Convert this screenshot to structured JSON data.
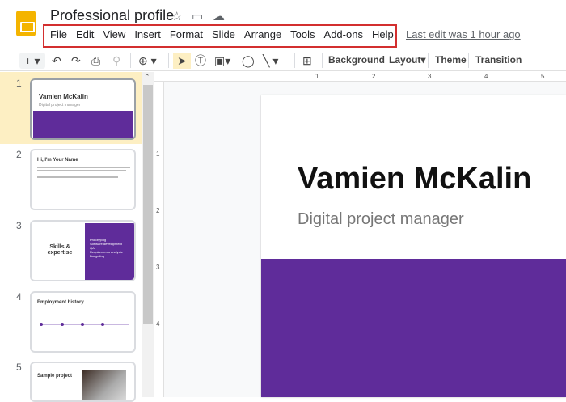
{
  "title": "Professional profile",
  "menu": [
    "File",
    "Edit",
    "View",
    "Insert",
    "Format",
    "Slide",
    "Arrange",
    "Tools",
    "Add-ons",
    "Help"
  ],
  "last_edit": "Last edit was 1 hour ago",
  "toolbar": {
    "background": "Background",
    "layout": "Layout",
    "theme": "Theme",
    "transition": "Transition"
  },
  "ruler": [
    "1",
    "2",
    "3",
    "4",
    "5"
  ],
  "vruler": [
    "1",
    "2",
    "3",
    "4"
  ],
  "slides": [
    {
      "num": "1",
      "title": "Vamien McKalin",
      "subtitle": "Digital project manager"
    },
    {
      "num": "2",
      "title": "Hi, I'm Your Name"
    },
    {
      "num": "3",
      "title": "Skills & expertise",
      "bullets": [
        "Prototyping",
        "Software development",
        "QA",
        "Requirements analysis",
        "Budgeting"
      ]
    },
    {
      "num": "4",
      "title": "Employment history"
    },
    {
      "num": "5",
      "title": "Sample project"
    }
  ],
  "main_slide": {
    "title": "Vamien McKalin",
    "subtitle": "Digital project manager"
  },
  "colors": {
    "accent": "#5f2c9a",
    "selection": "#fdefc3",
    "highlight_box": "#d32f2f"
  }
}
